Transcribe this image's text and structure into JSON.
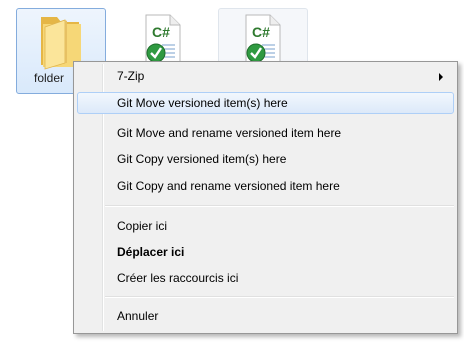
{
  "desktop": {
    "items": [
      {
        "label": "folder",
        "icon": "folder-icon",
        "selected": true
      },
      {
        "label": "",
        "icon": "csharp-file-icon",
        "selected": false
      },
      {
        "label": "",
        "icon": "csharp-file-icon",
        "selected": false
      }
    ]
  },
  "context_menu": {
    "items": [
      {
        "label": "7-Zip",
        "has_submenu": true
      },
      {
        "label": "Git Move versioned item(s) here",
        "highlighted": true
      },
      {
        "label": "Git Move and rename versioned item here"
      },
      {
        "label": "Git Copy versioned item(s) here"
      },
      {
        "label": "Git Copy and rename versioned item here"
      },
      {
        "label": "Copier ici"
      },
      {
        "label": "Déplacer ici",
        "bold": true
      },
      {
        "label": "Créer les raccourcis ici"
      },
      {
        "label": "Annuler"
      }
    ]
  },
  "csharp_icon_text": "C#",
  "colors": {
    "selection_border": "#84acdd",
    "menu_background": "#f0f0f0",
    "highlight_border": "#aecff7",
    "folder_yellow": "#f3cd5e",
    "csharp_green": "#2f9a41"
  }
}
